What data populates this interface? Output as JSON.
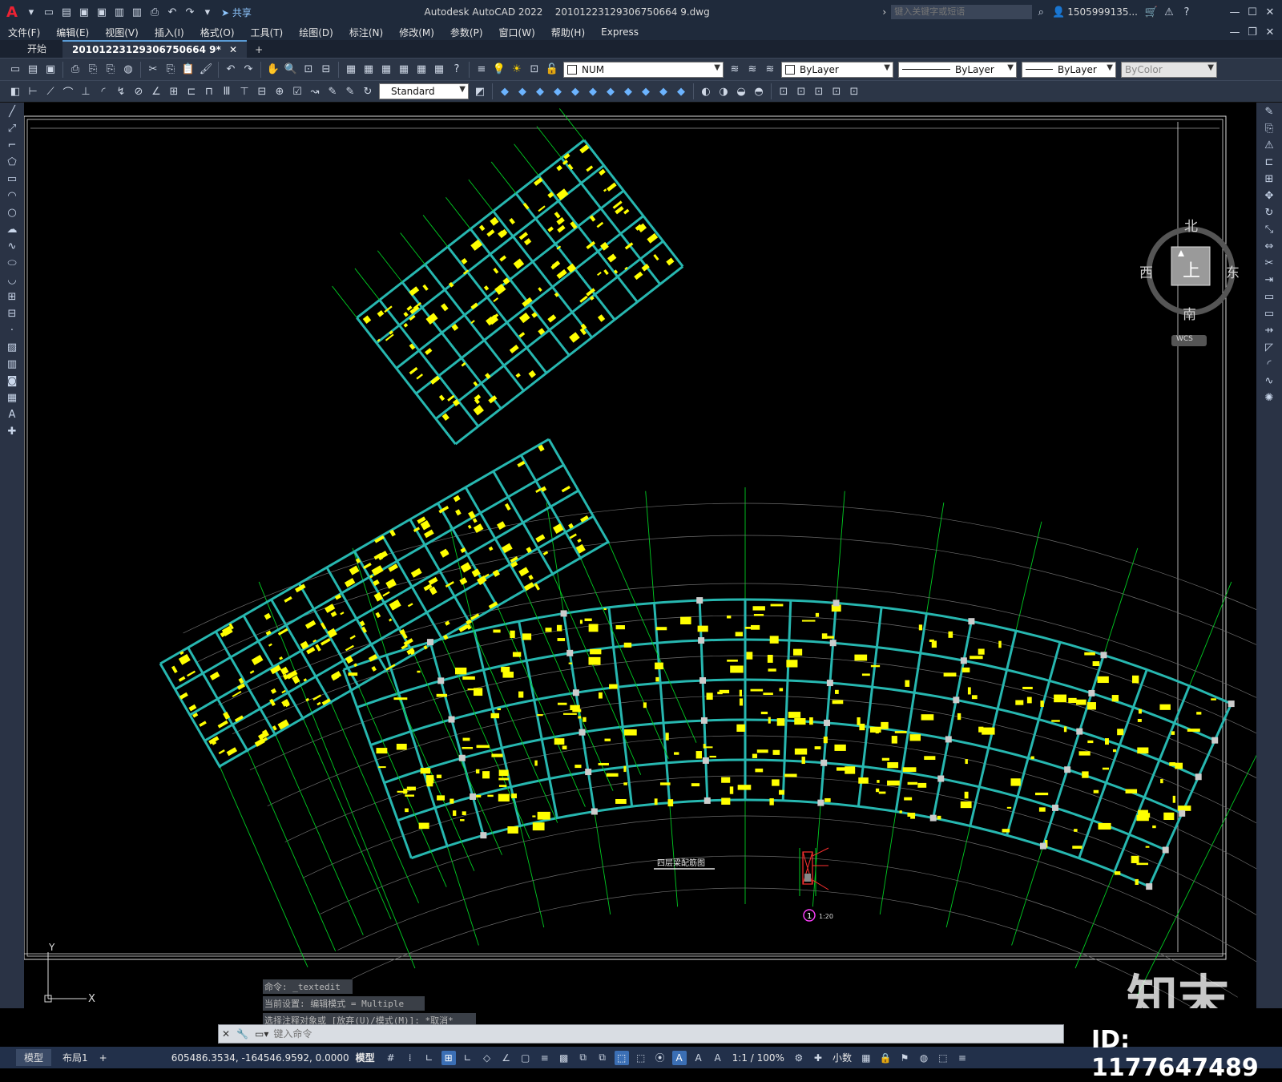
{
  "title_bar": {
    "app_name": "Autodesk AutoCAD 2022",
    "file_name": "20101223129306750664 9.dwg",
    "share_label": "共享",
    "search_placeholder": "键入关键字或短语",
    "user": "1505999135..."
  },
  "menu": [
    "文件(F)",
    "编辑(E)",
    "视图(V)",
    "插入(I)",
    "格式(O)",
    "工具(T)",
    "绘图(D)",
    "标注(N)",
    "修改(M)",
    "参数(P)",
    "窗口(W)",
    "帮助(H)",
    "Express"
  ],
  "tabs": {
    "start": "开始",
    "active": "20101223129306750664 9*",
    "add": "+"
  },
  "ribbon1": {
    "layer_value": "NUM",
    "color": "ByLayer",
    "linetype": "ByLayer",
    "lineweight": "ByLayer",
    "plotstyle": "ByColor"
  },
  "ribbon2": {
    "text_style": "Standard"
  },
  "viewcube": {
    "north": "北",
    "south": "南",
    "east": "东",
    "west": "西",
    "face": "上",
    "wcs": "WCS"
  },
  "drawing": {
    "plan_title": "四层梁配筋图",
    "detail_label": "1",
    "detail_scale": "1:20"
  },
  "command_history": [
    "命令: _textedit",
    "当前设置: 编辑模式 = Multiple",
    "选择注释对象或 [放弃(U)/模式(M)]: *取消*"
  ],
  "command_input_placeholder": "键入命令",
  "status": {
    "tabs": [
      "模型",
      "布局1"
    ],
    "coords": "605486.3534, -164546.9592, 0.0000",
    "space": "模型",
    "scale": "1:1 / 100%",
    "units": "小数"
  },
  "watermark": {
    "logo": "知末",
    "id": "ID: 1177647489"
  },
  "colors": {
    "beam": "#27b7b0",
    "axis": "#00cc22",
    "text": "#ffff00",
    "ui_dark": "#1f2a3b",
    "ribbon": "#2c3647"
  }
}
